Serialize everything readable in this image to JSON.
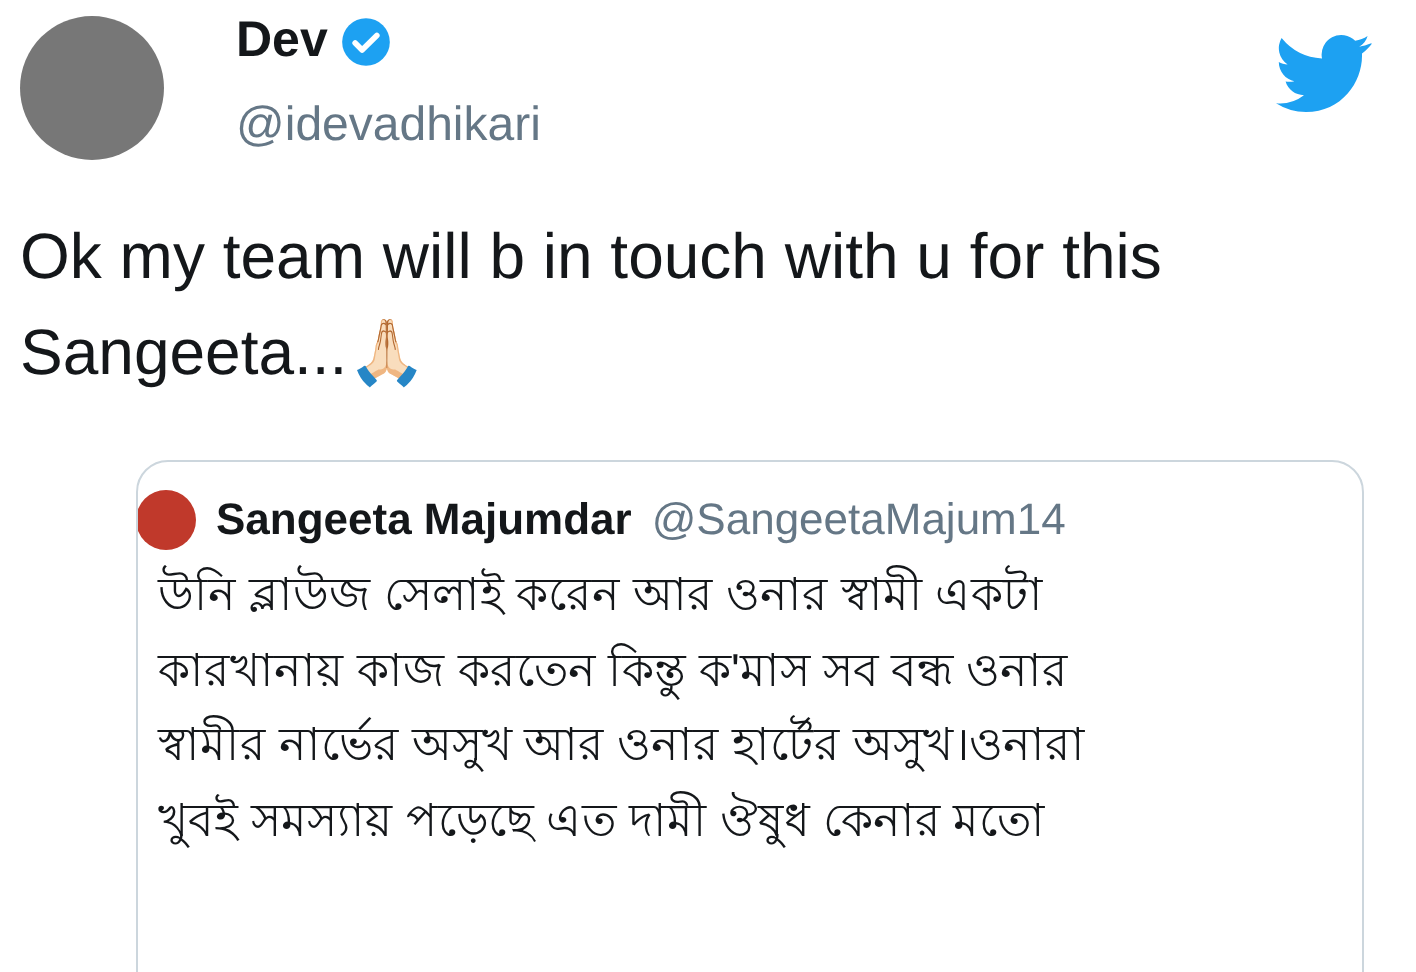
{
  "author": {
    "name": "Dev",
    "verified": true,
    "handle": "@idevadhikari"
  },
  "tweet_text": "Ok my team will b in touch with u for this Sangeeta...🙏🏻",
  "quoted_tweet": {
    "name": "Sangeeta Majumdar",
    "handle": "@SangeetaMajum14",
    "lines": [
      "উনি ব্লাউজ সেলাই করেন আর ওনার স্বামী একটা",
      "কারখানায় কাজ করতেন কিন্তু ক'মাস সব বন্ধ ওনার",
      "স্বামীর নার্ভের অসুখ আর ওনার হার্টের অসুখ।ওনারা",
      "খুবই সমস্যায় পড়েছে এত দামী ঔষুধ কেনার মতো"
    ]
  }
}
